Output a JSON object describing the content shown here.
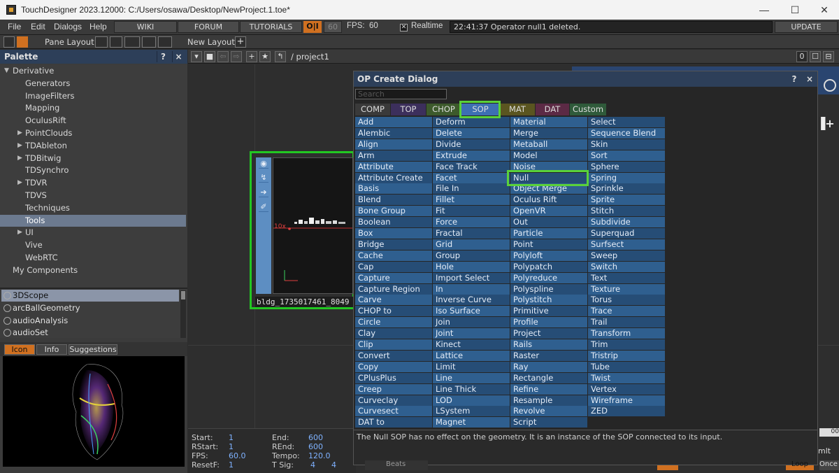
{
  "window": {
    "title": "TouchDesigner 2023.12000: C:/Users/osawa/Desktop/NewProject.1.toe*",
    "controls": [
      "—",
      "☐",
      "✕"
    ]
  },
  "menubar": {
    "menus": [
      "File",
      "Edit",
      "Dialogs",
      "Help"
    ],
    "buttons": [
      "WIKI",
      "FORUM",
      "TUTORIALS"
    ],
    "oj": "O|I",
    "fps_box": "60",
    "fps_label": "FPS:",
    "fps_value": "60",
    "realtime_label": "Realtime",
    "realtime_checked": "✕",
    "status": "22:41:37 Operator null1 deleted.",
    "update": "UPDATE"
  },
  "toolbar": {
    "pane_layout": "Pane Layout",
    "new_layout": "New Layout",
    "plus": "+"
  },
  "palette": {
    "title": "Palette",
    "help": "?",
    "close": "×",
    "tree": [
      {
        "label": "Derivative",
        "level": 0,
        "arrow": "▼"
      },
      {
        "label": "Generators",
        "level": 2,
        "arrow": ""
      },
      {
        "label": "ImageFilters",
        "level": 2,
        "arrow": ""
      },
      {
        "label": "Mapping",
        "level": 2,
        "arrow": ""
      },
      {
        "label": "OculusRift",
        "level": 2,
        "arrow": ""
      },
      {
        "label": "PointClouds",
        "level": 2,
        "arrow": "▶"
      },
      {
        "label": "TDAbleton",
        "level": 2,
        "arrow": "▶"
      },
      {
        "label": "TDBitwig",
        "level": 2,
        "arrow": "▶"
      },
      {
        "label": "TDSynchro",
        "level": 2,
        "arrow": ""
      },
      {
        "label": "TDVR",
        "level": 2,
        "arrow": "▶"
      },
      {
        "label": "TDVS",
        "level": 2,
        "arrow": ""
      },
      {
        "label": "Techniques",
        "level": 2,
        "arrow": ""
      },
      {
        "label": "Tools",
        "level": 2,
        "arrow": "",
        "selected": true
      },
      {
        "label": "UI",
        "level": 2,
        "arrow": "▶"
      },
      {
        "label": "Vive",
        "level": 2,
        "arrow": ""
      },
      {
        "label": "WebRTC",
        "level": 2,
        "arrow": ""
      },
      {
        "label": "My Components",
        "level": 1,
        "arrow": ""
      }
    ],
    "components": [
      "3DScope",
      "arcBallGeometry",
      "audioAnalysis",
      "audioSet"
    ],
    "info_tabs": [
      "Icon",
      "Info",
      "Suggestions"
    ]
  },
  "network": {
    "path": "/ project1",
    "counter": "0",
    "node_name": "bldg_1735017461_8049",
    "node_scale_label": "10x",
    "node_icons": [
      "◉",
      "↯",
      "➔",
      "✐"
    ]
  },
  "timeline": {
    "start_label": "Start:",
    "start": "1",
    "end_label": "End:",
    "end": "600",
    "rstart_label": "RStart:",
    "rstart": "1",
    "rend_label": "REnd:",
    "rend": "600",
    "fps_label": "FPS:",
    "fps": "60.0",
    "tempo_label": "Tempo:",
    "tempo": "120.0",
    "resetf_label": "ResetF:",
    "resetf": "1",
    "tsig_label": "T Sig:",
    "tsig_a": "4",
    "tsig_b": "4"
  },
  "dialog": {
    "title": "OP Create Dialog",
    "help": "?",
    "close": "×",
    "search_placeholder": "Search",
    "tabs": [
      {
        "label": "COMP",
        "color": "#3a3a3a"
      },
      {
        "label": "TOP",
        "color": "#3c2f5c"
      },
      {
        "label": "CHOP",
        "color": "#3d5a2c"
      },
      {
        "label": "SOP",
        "color": "#3d6fb3"
      },
      {
        "label": "MAT",
        "color": "#5a5520"
      },
      {
        "label": "DAT",
        "color": "#5c2a45"
      },
      {
        "label": "Custom",
        "color": "#2f5a3a"
      }
    ],
    "columns": [
      [
        "Add",
        "Alembic",
        "Align",
        "Arm",
        "Attribute",
        "Attribute Create",
        "Basis",
        "Blend",
        "Bone Group",
        "Boolean",
        "Box",
        "Bridge",
        "Cache",
        "Cap",
        "Capture",
        "Capture Region",
        "Carve",
        "CHOP to",
        "Circle",
        "Clay",
        "Clip",
        "Convert",
        "Copy",
        "CPlusPlus",
        "Creep",
        "Curveclay",
        "Curvesect",
        "DAT to"
      ],
      [
        "Deform",
        "Delete",
        "Divide",
        "Extrude",
        "Face Track",
        "Facet",
        "File In",
        "Fillet",
        "Fit",
        "Force",
        "Fractal",
        "Grid",
        "Group",
        "Hole",
        "Import Select",
        "In",
        "Inverse Curve",
        "Iso Surface",
        "Join",
        "Joint",
        "Kinect",
        "Lattice",
        "Limit",
        "Line",
        "Line Thick",
        "LOD",
        "LSystem",
        "Magnet"
      ],
      [
        "Material",
        "Merge",
        "Metaball",
        "Model",
        "Noise",
        "Null",
        "Object Merge",
        "Oculus Rift",
        "OpenVR",
        "Out",
        "Particle",
        "Point",
        "Polyloft",
        "Polypatch",
        "Polyreduce",
        "Polyspline",
        "Polystitch",
        "Primitive",
        "Profile",
        "Project",
        "Rails",
        "Raster",
        "Ray",
        "Rectangle",
        "Refine",
        "Resample",
        "Revolve",
        "Script"
      ],
      [
        "Select",
        "Sequence Blend",
        "Skin",
        "Sort",
        "Sphere",
        "Spring",
        "Sprinkle",
        "Sprite",
        "Stitch",
        "Subdivide",
        "Superquad",
        "Surfsect",
        "Sweep",
        "Switch",
        "Text",
        "Texture",
        "Torus",
        "Trace",
        "Trail",
        "Transform",
        "Trim",
        "Tristrip",
        "Tube",
        "Twist",
        "Vertex",
        "Wireframe",
        "ZED"
      ]
    ],
    "description": "The Null SOP has no effect on the geometry. It is an instance of the SOP connected to its input."
  },
  "colors": {
    "highlight": "#5ad13a",
    "title_blue": "#2d3f59",
    "accent_orange": "#d07020",
    "op_cell_a": "#2f5f8f",
    "op_cell_b": "#264d76"
  }
}
